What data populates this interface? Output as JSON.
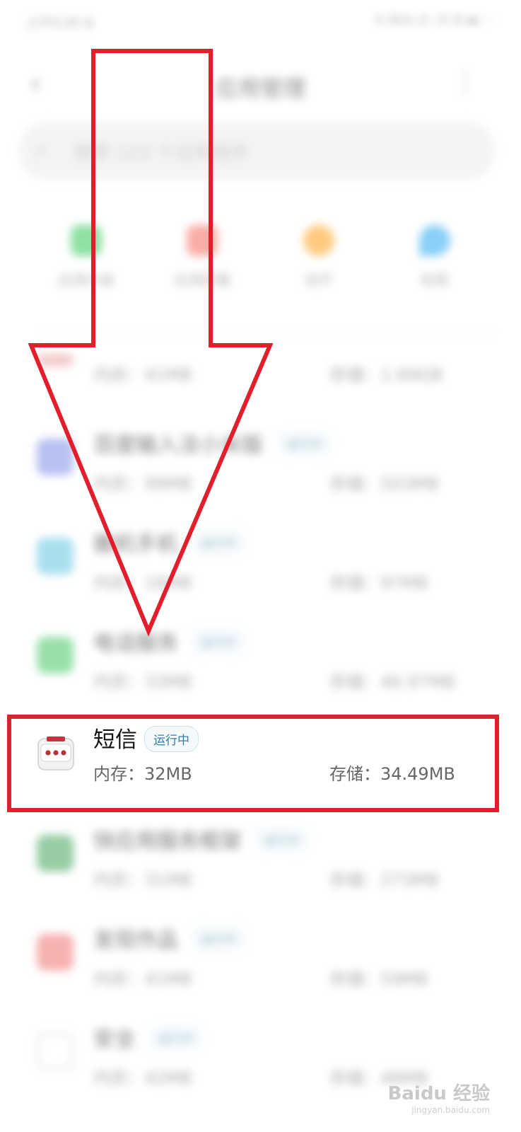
{
  "status_bar": {
    "left": "上午9:26 ⊕",
    "right": "4.3K/s ⊘ .ıll ◔ ▬ ⋯"
  },
  "header": {
    "title": "应用管理"
  },
  "search": {
    "placeholder": "搜索 123 个应用程序"
  },
  "quick_actions": [
    {
      "label": "应用升级",
      "color": "#34c759"
    },
    {
      "label": "应用卸载",
      "color": "#f46b5f"
    },
    {
      "label": "双开",
      "color": "#ff9f1a"
    },
    {
      "label": "权限",
      "color": "#2aa8f2"
    }
  ],
  "apps": [
    {
      "name": "",
      "badge": "",
      "memory": "内存：41MB",
      "storage": "存储：1.69GB",
      "icon_color": "#e8a0a0"
    },
    {
      "name": "百度输入法小米版",
      "badge": "运行中",
      "memory": "内存：99MB",
      "storage": "存储：503MB",
      "icon_color": "#7d8fe6"
    },
    {
      "name": "搬机手机",
      "badge": "运行中",
      "memory": "内存：16MB",
      "storage": "存储：97MB",
      "icon_color": "#63c6e0"
    },
    {
      "name": "电话服务",
      "badge": "运行中",
      "memory": "内存：33MB",
      "storage": "存储：46.97MB",
      "icon_color": "#45c866"
    },
    {
      "name": "短信",
      "badge": "运行中",
      "memory": "内存：32MB",
      "storage": "存储：34.49MB",
      "icon_color": "#ffffff"
    },
    {
      "name": "快应用服务框架",
      "badge": "运行中",
      "memory": "内存：31MB",
      "storage": "存储：273MB",
      "icon_color": "#3fa45b"
    },
    {
      "name": "发现作品",
      "badge": "运行中",
      "memory": "内存：41MB",
      "storage": "存储：59MB",
      "icon_color": "#f07171"
    },
    {
      "name": "安全",
      "badge": "运行中",
      "memory": "内存：42MB",
      "storage": "存储：48MB",
      "icon_color": "#dddddd"
    }
  ],
  "watermark": {
    "text": "Baidu 经验",
    "sub": "jingyan.baidu.com"
  },
  "accent_color": "#e31e2c"
}
